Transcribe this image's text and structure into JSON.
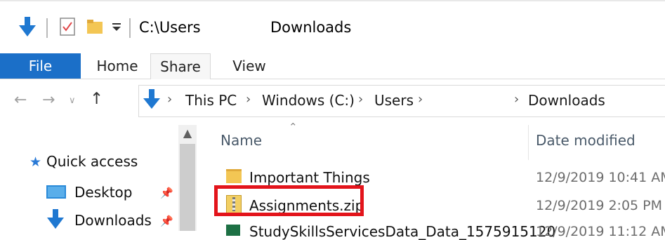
{
  "window": {
    "path_prefix": "C:\\Users",
    "path_suffix": "Downloads"
  },
  "ribbon": {
    "tabs": [
      "File",
      "Home",
      "Share",
      "View"
    ]
  },
  "address_bar": {
    "crumbs": [
      "This PC",
      "Windows (C:)",
      "Users",
      "Downloads"
    ]
  },
  "nav_pane": {
    "items": [
      "Quick access",
      "Desktop",
      "Downloads"
    ]
  },
  "file_list": {
    "columns": {
      "name": "Name",
      "date": "Date modified"
    },
    "rows": [
      {
        "name": "Important Things",
        "date": "12/9/2019 10:41 AM",
        "icon": "folder-icon"
      },
      {
        "name": "Assignments.zip",
        "date": "12/9/2019 2:05 PM",
        "icon": "zip-icon"
      },
      {
        "name": "StudySkillsServicesData_Data_1575915120",
        "date": "12/9/2019 11:12 AM",
        "icon": "excel-icon"
      }
    ]
  },
  "colors": {
    "accent": "#1b6fc8",
    "highlight": "#e3141b",
    "folder": "#f3c654"
  }
}
